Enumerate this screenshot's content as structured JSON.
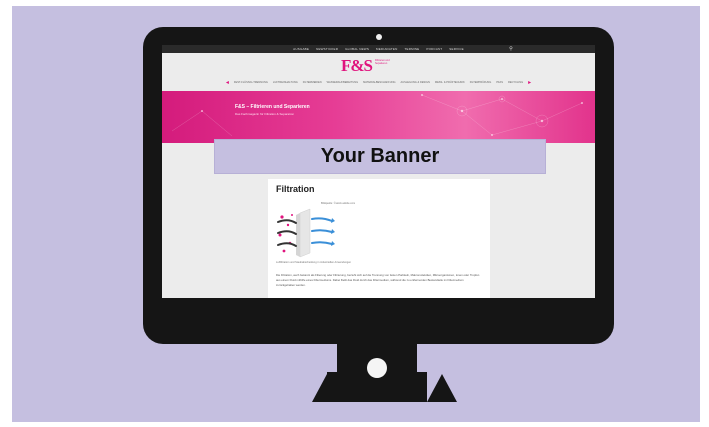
{
  "site": {
    "topnav": [
      "AUSGABE",
      "NEWSTICKER",
      "GLOBAL NEWS",
      "MEDIADATEN",
      "TERMINE",
      "PODCAST",
      "SERVICE"
    ],
    "logo_text": "F&S",
    "logo_sub": "Filtrieren und Separieren",
    "categories": [
      "FEST-FLÜSSIG-TRENNUNG",
      "LUFTREINHALTUNG",
      "FILTERMEDIEN",
      "WASSERAUFBEREITUNG",
      "MATERIALBESCHAFFUNG",
      "AUSLEGUNG & DESIGN",
      "MESS- & PRÜFTECHNIK",
      "FILTERPRÜFUNG",
      "PFAS",
      "RECYCLING"
    ],
    "hero_title": "F&S – Filtrieren und Separieren",
    "hero_subtitle": "Das Fachmagazin für Filtration & Separation"
  },
  "banner": {
    "label": "Your Banner"
  },
  "article": {
    "title": "Filtration",
    "image_caption": "Bildquelle: ©stock.adobe.com",
    "image_subcaption": "Luftfiltration und Staubabscheidung in industriellen Anwendungen",
    "body": "Die Filtration, auch bekannt als Filterung oder Filtrierung, bezieht sich auf die Trennung von festen Partikeln, Makromolekülen, Mikroorganismen, Ionen oder Tropfen aus einem Fluid mithilfe eines Filtermediums. Dabei fließt das Fluid durch das Filtermedium, während die zu entfernenden Bestandteile im Filtermedium zurückgehalten werden."
  },
  "colors": {
    "brand": "#e0147e",
    "background": "#c5bfe0",
    "bezel": "#151515"
  }
}
